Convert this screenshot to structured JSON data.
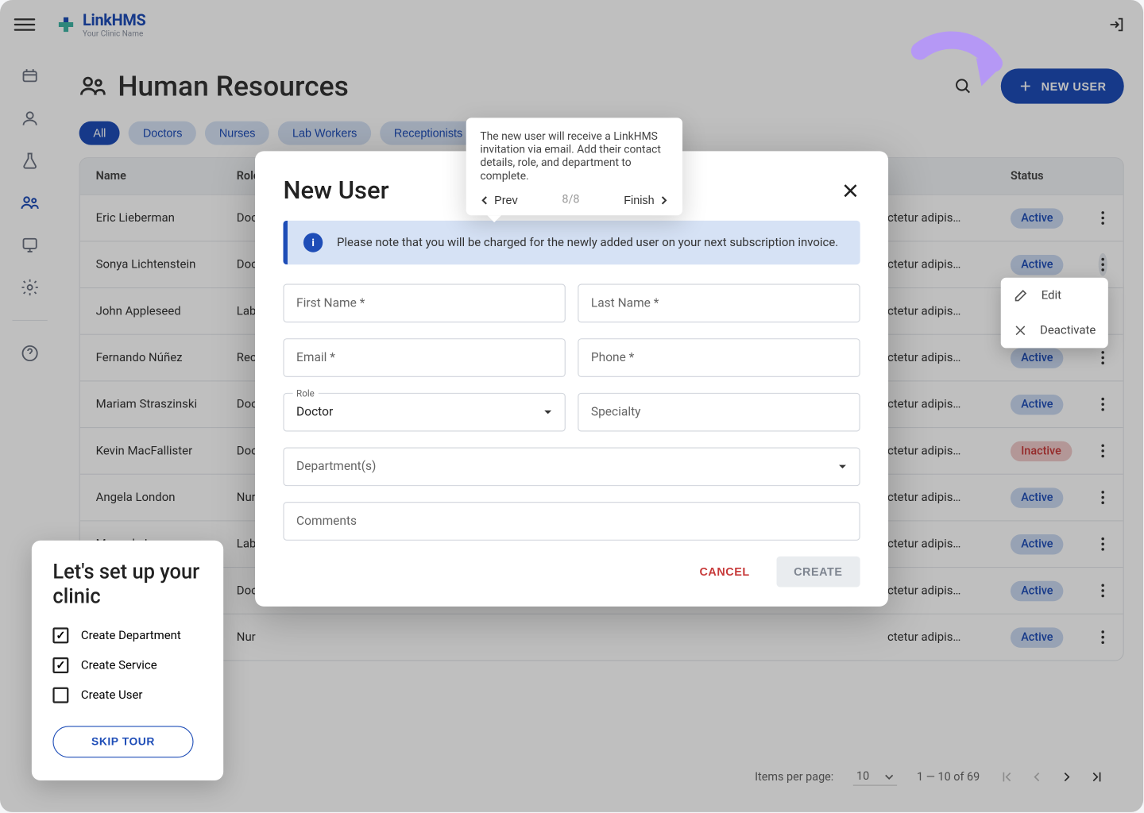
{
  "app": {
    "brand": "LinkHMS",
    "clinic": "Your Clinic Name"
  },
  "header": {
    "title": "Human Resources",
    "new_user": "NEW USER"
  },
  "filters": [
    "All",
    "Doctors",
    "Nurses",
    "Lab Workers",
    "Receptionists"
  ],
  "table": {
    "columns": {
      "name": "Name",
      "role": "Role",
      "status": "Status"
    },
    "cell_trunc": "ctetur adipis…",
    "rows": [
      {
        "name": "Eric Lieberman",
        "role": "Doc",
        "status": "Active"
      },
      {
        "name": "Sonya Lichtenstein",
        "role": "Doc",
        "status": "Active"
      },
      {
        "name": "John Appleseed",
        "role": "Lab",
        "status": "Active"
      },
      {
        "name": "Fernando Núñez",
        "role": "Rec",
        "status": "Active"
      },
      {
        "name": "Mariam Straszinski",
        "role": "Doc",
        "status": "Active"
      },
      {
        "name": "Kevin MacFallister",
        "role": "Doc",
        "status": "Inactive"
      },
      {
        "name": "Angela London",
        "role": "Nur",
        "status": "Active"
      },
      {
        "name": "Manuela Lopez",
        "role": "Lab",
        "status": "Active"
      },
      {
        "name": "",
        "role": "Doc",
        "status": "Active"
      },
      {
        "name": "",
        "role": "Nur",
        "status": "Active"
      }
    ]
  },
  "pagination": {
    "label": "Items per page:",
    "page_size": "10",
    "range": "1 — 10 of 69"
  },
  "tour_pop": {
    "text": "The new user will receive a LinkHMS invitation via email. Add their contact details, role, and department to complete.",
    "prev": "Prev",
    "count": "8/8",
    "finish": "Finish"
  },
  "row_menu": {
    "edit": "Edit",
    "deactivate": "Deactivate"
  },
  "onboard": {
    "title": "Let's set up your clinic",
    "items": [
      {
        "label": "Create Department",
        "checked": true
      },
      {
        "label": "Create Service",
        "checked": true
      },
      {
        "label": "Create User",
        "checked": false
      }
    ],
    "skip": "SKIP TOUR"
  },
  "dialog": {
    "title": "New User",
    "banner": "Please note that you will be charged for the newly added user on your next subscription invoice.",
    "fields": {
      "first_name": "First Name *",
      "last_name": "Last Name *",
      "email": "Email *",
      "phone": "Phone *",
      "role_label": "Role",
      "role_value": "Doctor",
      "specialty": "Specialty",
      "departments": "Department(s)",
      "comments": "Comments"
    },
    "cancel": "CANCEL",
    "create": "CREATE"
  }
}
